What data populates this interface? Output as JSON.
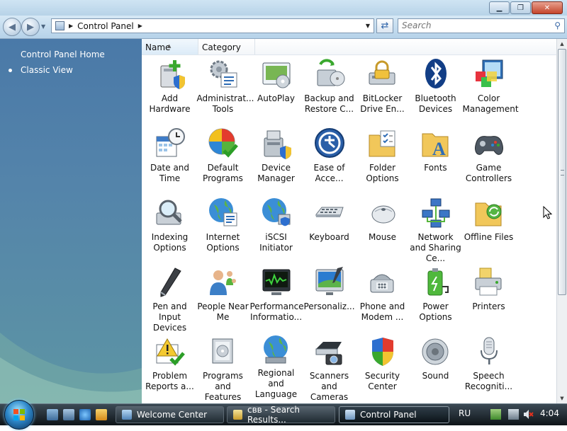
{
  "window": {
    "controls": [
      "minimize",
      "maximize",
      "close"
    ]
  },
  "nav": {
    "breadcrumb": "Control Panel",
    "search_placeholder": "Search"
  },
  "left_pane": {
    "links": [
      "Control Panel Home",
      "Classic View"
    ]
  },
  "columns": [
    "Name",
    "Category"
  ],
  "items": [
    {
      "label": "Add Hardware",
      "icon": "add-hardware-icon"
    },
    {
      "label": "Administrat... Tools",
      "icon": "administrative-tools-icon"
    },
    {
      "label": "AutoPlay",
      "icon": "autoplay-icon"
    },
    {
      "label": "Backup and Restore C...",
      "icon": "backup-restore-icon"
    },
    {
      "label": "BitLocker Drive En...",
      "icon": "bitlocker-icon"
    },
    {
      "label": "Bluetooth Devices",
      "icon": "bluetooth-icon"
    },
    {
      "label": "Color Management",
      "icon": "color-management-icon"
    },
    {
      "label": "Date and Time",
      "icon": "date-time-icon"
    },
    {
      "label": "Default Programs",
      "icon": "default-programs-icon"
    },
    {
      "label": "Device Manager",
      "icon": "device-manager-icon"
    },
    {
      "label": "Ease of Acce...",
      "icon": "ease-of-access-icon"
    },
    {
      "label": "Folder Options",
      "icon": "folder-options-icon"
    },
    {
      "label": "Fonts",
      "icon": "fonts-icon"
    },
    {
      "label": "Game Controllers",
      "icon": "game-controllers-icon"
    },
    {
      "label": "Indexing Options",
      "icon": "indexing-options-icon"
    },
    {
      "label": "Internet Options",
      "icon": "internet-options-icon"
    },
    {
      "label": "iSCSI Initiator",
      "icon": "iscsi-initiator-icon"
    },
    {
      "label": "Keyboard",
      "icon": "keyboard-icon"
    },
    {
      "label": "Mouse",
      "icon": "mouse-icon"
    },
    {
      "label": "Network and Sharing Ce...",
      "icon": "network-sharing-icon"
    },
    {
      "label": "Offline Files",
      "icon": "offline-files-icon"
    },
    {
      "label": "Pen and Input Devices",
      "icon": "pen-input-icon"
    },
    {
      "label": "People Near Me",
      "icon": "people-near-me-icon"
    },
    {
      "label": "Performance Informatio...",
      "icon": "performance-icon"
    },
    {
      "label": "Personaliz...",
      "icon": "personalization-icon"
    },
    {
      "label": "Phone and Modem ...",
      "icon": "phone-modem-icon"
    },
    {
      "label": "Power Options",
      "icon": "power-options-icon"
    },
    {
      "label": "Printers",
      "icon": "printers-icon"
    },
    {
      "label": "Problem Reports a...",
      "icon": "problem-reports-icon"
    },
    {
      "label": "Programs and Features",
      "icon": "programs-features-icon"
    },
    {
      "label": "Regional and Language ...",
      "icon": "regional-language-icon"
    },
    {
      "label": "Scanners and Cameras",
      "icon": "scanners-cameras-icon"
    },
    {
      "label": "Security Center",
      "icon": "security-center-icon"
    },
    {
      "label": "Sound",
      "icon": "sound-icon"
    },
    {
      "label": "Speech Recogniti...",
      "icon": "speech-recognition-icon"
    }
  ],
  "taskbar": {
    "tasks": [
      "Welcome Center",
      "свв - Search Results...",
      "Control Panel"
    ],
    "active_task": "Control Panel",
    "language": "RU",
    "clock": "4:04"
  },
  "colors": {
    "left_pane_top": "#4a79a8",
    "left_pane_bottom": "#5d95a4",
    "taskbar": "#1f2a31"
  }
}
